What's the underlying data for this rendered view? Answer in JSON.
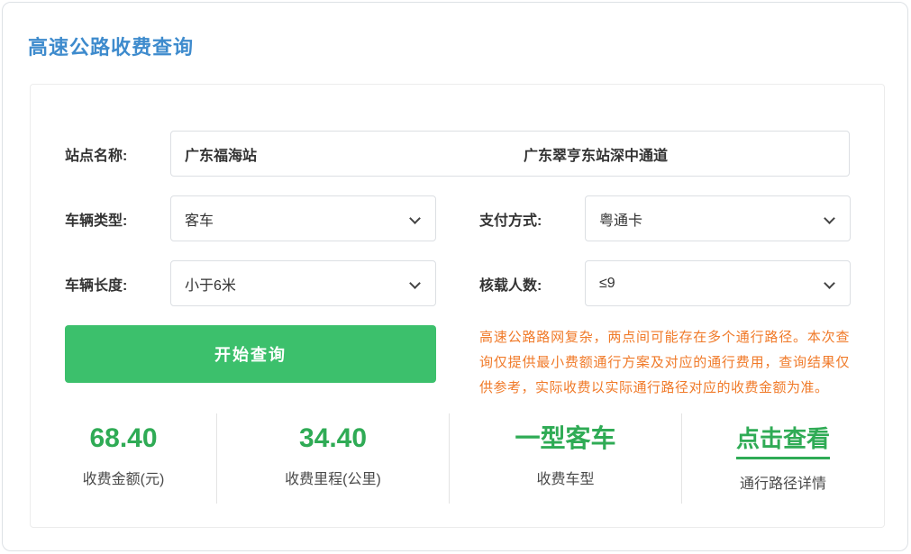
{
  "page": {
    "title": "高速公路收费查询"
  },
  "form": {
    "station": {
      "label": "站点名称:",
      "from_value": "广东福海站",
      "to_value": "广东翠亨东站深中通道"
    },
    "vehicle_type": {
      "label": "车辆类型:",
      "value": "客车"
    },
    "payment_method": {
      "label": "支付方式:",
      "value": "粤通卡"
    },
    "vehicle_length": {
      "label": "车辆长度:",
      "value": "小于6米"
    },
    "passenger_capacity": {
      "label": "核载人数:",
      "value": "≤9"
    },
    "query_button_label": "开始查询",
    "notice_text": "高速公路路网复杂，两点间可能存在多个通行路径。本次查询仅提供最小费额通行方案及对应的通行费用，查询结果仅供参考，实际收费以实际通行路径对应的收费金额为准。"
  },
  "results": {
    "items": [
      {
        "value": "68.40",
        "label": "收费金额(元)"
      },
      {
        "value": "34.40",
        "label": "收费里程(公里)"
      },
      {
        "value": "一型客车",
        "label": "收费车型"
      },
      {
        "value": "点击查看",
        "label": "通行路径详情"
      }
    ]
  },
  "colors": {
    "title_blue": "#3e8bcd",
    "button_green": "#3cc06c",
    "value_green": "#2fab55",
    "notice_orange": "#f07a29"
  }
}
